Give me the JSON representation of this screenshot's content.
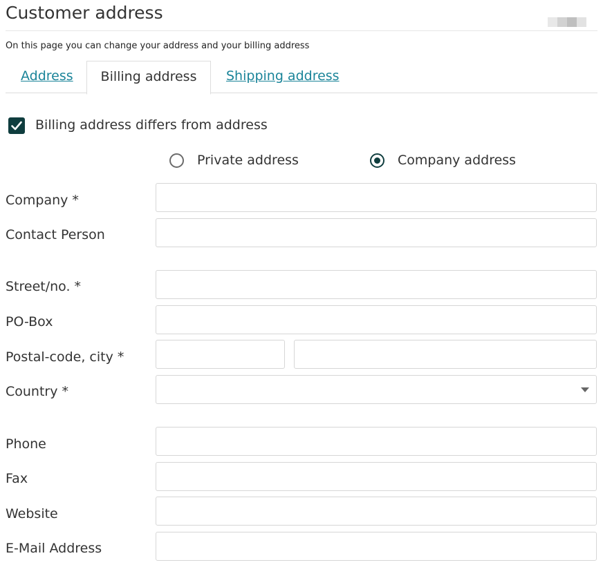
{
  "page": {
    "title": "Customer address",
    "subtitle": "On this page you can change your address and your billing address"
  },
  "tabs": [
    {
      "label": "Address",
      "active": false
    },
    {
      "label": "Billing address",
      "active": true
    },
    {
      "label": "Shipping address",
      "active": false
    }
  ],
  "billing_toggle": {
    "label": "Billing address differs from address",
    "checked": true
  },
  "address_type": {
    "options": [
      {
        "label": "Private address",
        "selected": false
      },
      {
        "label": "Company address",
        "selected": true
      }
    ]
  },
  "form": {
    "company": {
      "label": "Company *",
      "value": ""
    },
    "contact_person": {
      "label": "Contact Person",
      "value": ""
    },
    "street": {
      "label": "Street/no. *",
      "value": ""
    },
    "po_box": {
      "label": "PO-Box",
      "value": ""
    },
    "postal_city": {
      "label": "Postal-code, city *",
      "postal_value": "",
      "city_value": ""
    },
    "country": {
      "label": "Country *",
      "value": ""
    },
    "phone": {
      "label": "Phone",
      "value": ""
    },
    "fax": {
      "label": "Fax",
      "value": ""
    },
    "website": {
      "label": "Website",
      "value": ""
    },
    "email": {
      "label": "E-Mail Address",
      "value": ""
    }
  },
  "colors": {
    "accent_dark": "#0f3d3e",
    "link": "#1a8499",
    "border": "#d6d6d6"
  }
}
